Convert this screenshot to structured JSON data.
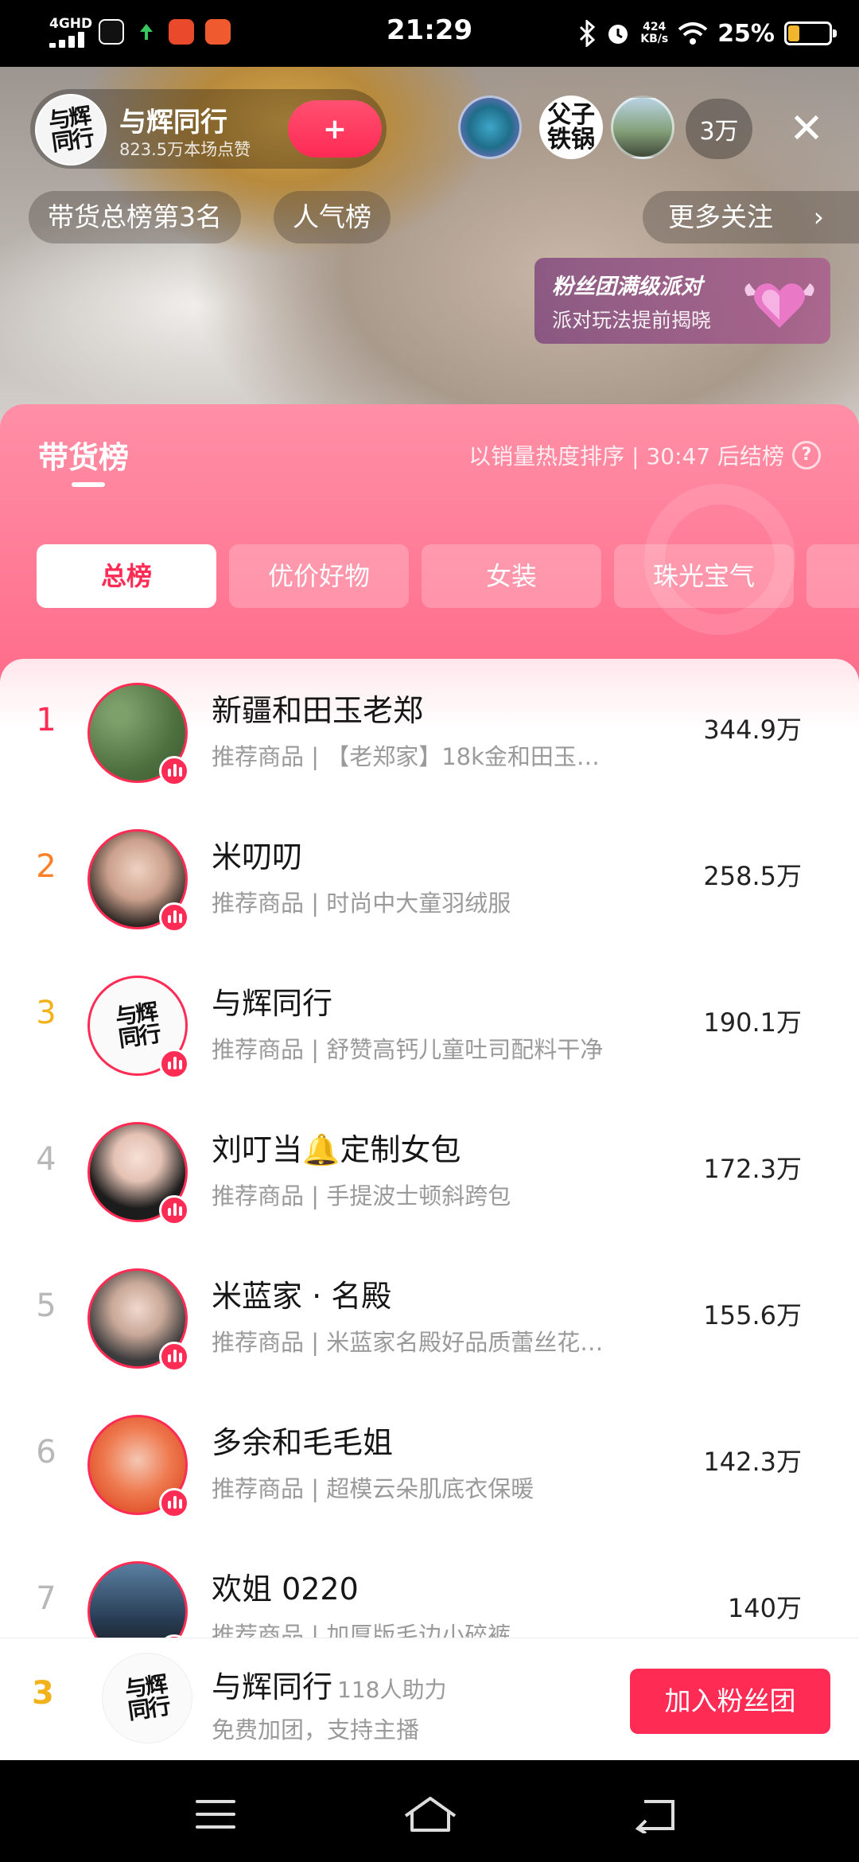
{
  "status_bar": {
    "network": "4GHD",
    "time": "21:29",
    "speed_value": "424",
    "speed_unit": "KB/s",
    "battery_text": "25%",
    "battery_level": 0.25,
    "battery_color": "#f2b62c"
  },
  "live": {
    "anchor_name": "与辉同行",
    "anchor_likes": "823.5万本场点赞",
    "follow_symbol": "+",
    "viewer_avatar_text": "父子\n铁锅",
    "viewer_count": "3万",
    "close_symbol": "✕",
    "tags": [
      "带货总榜第3名",
      "人气榜"
    ],
    "more_follow": "更多关注",
    "more_follow_arrow": "›",
    "party_title": "粉丝团满级派对",
    "party_subtitle": "派对玩法提前揭晓"
  },
  "ranking": {
    "title": "带货榜",
    "info": "以销量热度排序 | 30:47 后结榜",
    "help_symbol": "?",
    "categories": [
      "总榜",
      "优价好物",
      "女装",
      "珠光宝气",
      ""
    ],
    "rows": [
      {
        "rank": "1",
        "name": "新疆和田玉老郑",
        "subtitle": "推荐商品 | 【老郑家】18k金和田玉…",
        "score": "344.9万"
      },
      {
        "rank": "2",
        "name": "米叨叨",
        "subtitle": "推荐商品 | 时尚中大童羽绒服",
        "score": "258.5万"
      },
      {
        "rank": "3",
        "name": "与辉同行",
        "subtitle": "推荐商品 | 舒赞高钙儿童吐司配料干净",
        "score": "190.1万"
      },
      {
        "rank": "4",
        "name": "刘叮当🔔定制女包",
        "subtitle": "推荐商品 | 手提波士顿斜跨包",
        "score": "172.3万"
      },
      {
        "rank": "5",
        "name": "米蓝家 · 名殿",
        "subtitle": "推荐商品 | 米蓝家名殿好品质蕾丝花…",
        "score": "155.6万"
      },
      {
        "rank": "6",
        "name": "多余和毛毛姐",
        "subtitle": "推荐商品 | 超模云朵肌底衣保暖",
        "score": "142.3万"
      },
      {
        "rank": "7",
        "name": "欢姐 0220",
        "subtitle": "推荐商品 | 加厚版毛边小碎裤",
        "score": "140万"
      }
    ]
  },
  "logo_text": "与辉\n同行",
  "my_rank": {
    "rank": "3",
    "name": "与辉同行",
    "support": "118人助力",
    "subtitle": "免费加团，支持主播",
    "join_label": "加入粉丝团"
  },
  "colors": {
    "accent": "#fe2c55",
    "rank1": "#fe2c55",
    "rank2": "#ff7f27",
    "rank3": "#f2b21b"
  }
}
